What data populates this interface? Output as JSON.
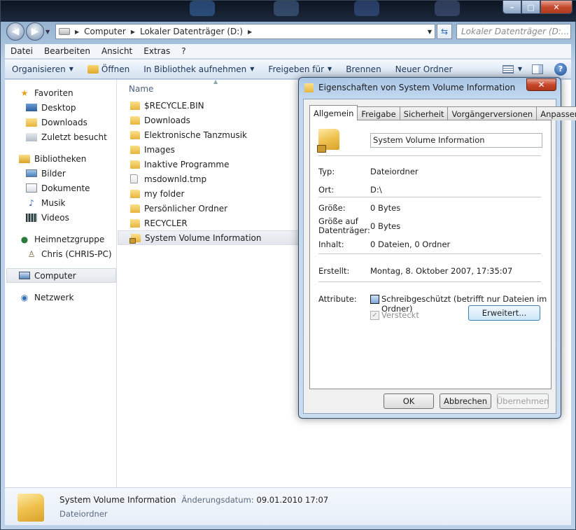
{
  "explorer": {
    "caption": {
      "minimize": "–",
      "maximize": "□",
      "close": "✕"
    },
    "address": {
      "segments": [
        "Computer",
        "Lokaler Datenträger (D:)"
      ],
      "search_placeholder": "Lokaler Datenträger (D:..."
    },
    "menu": [
      "Datei",
      "Bearbeiten",
      "Ansicht",
      "Extras",
      "?"
    ],
    "commands": {
      "organize": "Organisieren",
      "open": "Öffnen",
      "include_library": "In Bibliothek aufnehmen",
      "share": "Freigeben für",
      "burn": "Brennen",
      "new_folder": "Neuer Ordner"
    },
    "nav": {
      "favorites": "Favoriten",
      "desktop": "Desktop",
      "downloads": "Downloads",
      "recent": "Zuletzt besucht",
      "libraries": "Bibliotheken",
      "pictures": "Bilder",
      "documents": "Dokumente",
      "music": "Musik",
      "videos": "Videos",
      "homegroup": "Heimnetzgruppe",
      "homegroup_user": "Chris (CHRIS-PC)",
      "computer": "Computer",
      "network": "Netzwerk"
    },
    "column_name": "Name",
    "files": [
      "$RECYCLE.BIN",
      "Downloads",
      "Elektronische Tanzmusik",
      "Images",
      "Inaktive Programme",
      "msdownld.tmp",
      "my folder",
      "Persönlicher Ordner",
      "RECYCLER",
      "System Volume Information"
    ],
    "details": {
      "name": "System Volume Information",
      "modified_label": "Änderungsdatum:",
      "modified_value": "09.01.2010 17:07",
      "type": "Dateiordner"
    }
  },
  "dialog": {
    "title": "Eigenschaften von System Volume Information",
    "close": "✕",
    "tabs": [
      "Allgemein",
      "Freigabe",
      "Sicherheit",
      "Vorgängerversionen",
      "Anpassen"
    ],
    "name_value": "System Volume Information",
    "props": {
      "type_label": "Typ:",
      "type_value": "Dateiordner",
      "location_label": "Ort:",
      "location_value": "D:\\",
      "size_label": "Größe:",
      "size_value": "0 Bytes",
      "size_disk_label_1": "Größe auf",
      "size_disk_label_2": "Datenträger:",
      "size_disk_value": "0 Bytes",
      "contains_label": "Inhalt:",
      "contains_value": "0 Dateien, 0 Ordner",
      "created_label": "Erstellt:",
      "created_value": "Montag, 8. Oktober 2007, 17:35:07",
      "attributes_label": "Attribute:",
      "readonly": "Schreibgeschützt (betrifft nur Dateien im Ordner)",
      "hidden": "Versteckt",
      "advanced": "Erweitert..."
    },
    "buttons": {
      "ok": "OK",
      "cancel": "Abbrechen",
      "apply": "Übernehmen"
    }
  }
}
